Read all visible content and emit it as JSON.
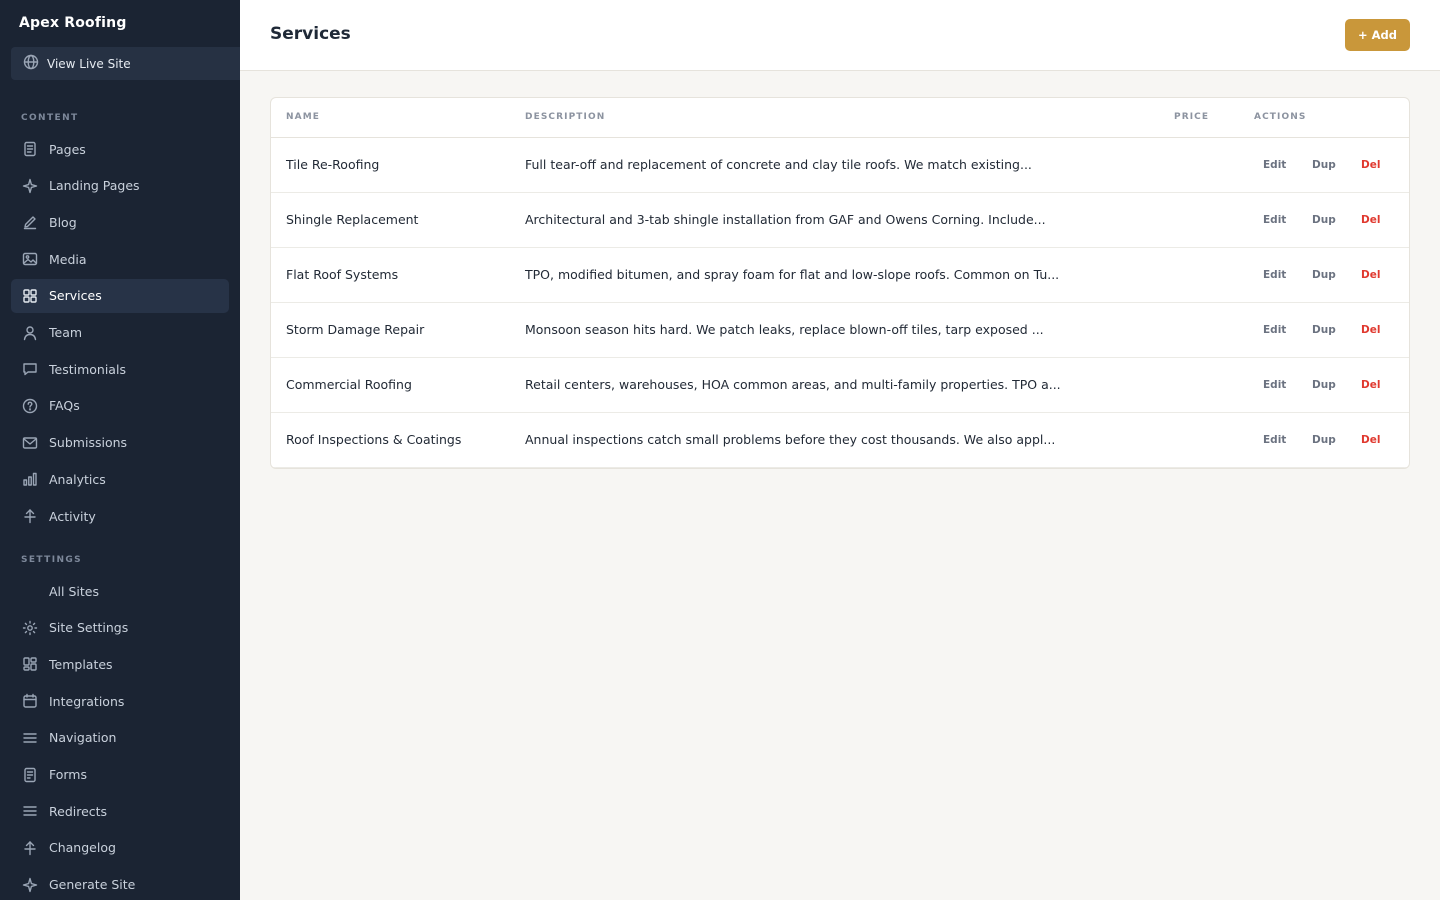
{
  "sidebar": {
    "brand": "Apex Roofing",
    "live_site": "View Live Site",
    "content_label": "CONTENT",
    "settings_label": "SETTINGS",
    "content_items": [
      {
        "label": "Pages",
        "icon": "document-icon"
      },
      {
        "label": "Landing Pages",
        "icon": "sparkle-icon"
      },
      {
        "label": "Blog",
        "icon": "pencil-icon"
      },
      {
        "label": "Media",
        "icon": "image-icon"
      },
      {
        "label": "Services",
        "icon": "grid-icon",
        "active": true
      },
      {
        "label": "Team",
        "icon": "person-icon"
      },
      {
        "label": "Testimonials",
        "icon": "chat-icon"
      },
      {
        "label": "FAQs",
        "icon": "question-icon"
      },
      {
        "label": "Submissions",
        "icon": "mail-icon"
      },
      {
        "label": "Analytics",
        "icon": "bar-chart-icon"
      },
      {
        "label": "Activity",
        "icon": "pulse-icon"
      }
    ],
    "settings_items": [
      {
        "label": "All Sites",
        "icon": ""
      },
      {
        "label": "Site Settings",
        "icon": "gear-icon"
      },
      {
        "label": "Templates",
        "icon": "template-icon"
      },
      {
        "label": "Integrations",
        "icon": "calendar-icon"
      },
      {
        "label": "Navigation",
        "icon": "menu-icon"
      },
      {
        "label": "Forms",
        "icon": "form-icon"
      },
      {
        "label": "Redirects",
        "icon": "menu-icon"
      },
      {
        "label": "Changelog",
        "icon": "pulse-icon"
      },
      {
        "label": "Generate Site",
        "icon": "sparkle-icon"
      }
    ]
  },
  "header": {
    "title": "Services",
    "add_label": "+ Add"
  },
  "table": {
    "columns": {
      "name": "NAME",
      "description": "DESCRIPTION",
      "price": "PRICE",
      "actions": "ACTIONS"
    },
    "rows": [
      {
        "name": "Tile Re-Roofing",
        "description": "Full tear-off and replacement of concrete and clay tile roofs. We match existing...",
        "price": ""
      },
      {
        "name": "Shingle Replacement",
        "description": "Architectural and 3-tab shingle installation from GAF and Owens Corning. Include...",
        "price": ""
      },
      {
        "name": "Flat Roof Systems",
        "description": "TPO, modified bitumen, and spray foam for flat and low-slope roofs. Common on Tu...",
        "price": ""
      },
      {
        "name": "Storm Damage Repair",
        "description": "Monsoon season hits hard. We patch leaks, replace blown-off tiles, tarp exposed ...",
        "price": ""
      },
      {
        "name": "Commercial Roofing",
        "description": "Retail centers, warehouses, HOA common areas, and multi-family properties. TPO a...",
        "price": ""
      },
      {
        "name": "Roof Inspections & Coatings",
        "description": "Annual inspections catch small problems before they cost thousands. We also appl...",
        "price": ""
      }
    ],
    "action_labels": {
      "edit": "Edit",
      "dup": "Dup",
      "del": "Del"
    }
  },
  "colors": {
    "sidebar_bg": "#1b2433",
    "accent": "#c9973a",
    "danger": "#e0392f"
  }
}
